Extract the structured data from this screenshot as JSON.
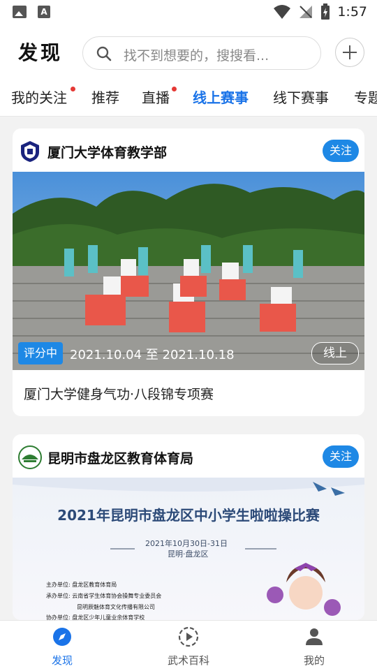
{
  "status_bar": {
    "time": "1:57"
  },
  "header": {
    "title": "发现",
    "search_placeholder": "找不到想要的，搜搜看..."
  },
  "tabs": [
    {
      "label": "我的关注",
      "dot": true
    },
    {
      "label": "推荐",
      "dot": false
    },
    {
      "label": "直播",
      "dot": true
    },
    {
      "label": "线上赛事",
      "active": true
    },
    {
      "label": "线下赛事"
    },
    {
      "label": "专题"
    }
  ],
  "cards": [
    {
      "org": "厦门大学体育教学部",
      "follow_label": "关注",
      "status": "评分中",
      "date_range": "2021.10.04 至 2021.10.18",
      "mode": "线上",
      "title": "厦门大学健身气功·八段锦专项赛"
    },
    {
      "org": "昆明市盘龙区教育体育局",
      "follow_label": "关注",
      "poster": {
        "headline": "2021年昆明市盘龙区中小学生啦啦操比赛",
        "date": "2021年10月30日-31日",
        "place": "昆明·盘龙区",
        "lines": [
          "主办单位:  盘龙区教育体育局",
          "承办单位:  云南省学生体育协会操舞专业委员会",
          "昆明辰魅体育文化传播有限公司",
          "协办单位:  盘龙区少年儿童业余体育学校"
        ]
      }
    }
  ],
  "bottom_nav": [
    {
      "label": "发现",
      "icon": "compass-icon",
      "active": true
    },
    {
      "label": "武术百科",
      "icon": "play-circle-icon"
    },
    {
      "label": "我的",
      "icon": "person-icon"
    }
  ],
  "colors": {
    "accent": "#1e88e5",
    "dot": "#e53935"
  }
}
